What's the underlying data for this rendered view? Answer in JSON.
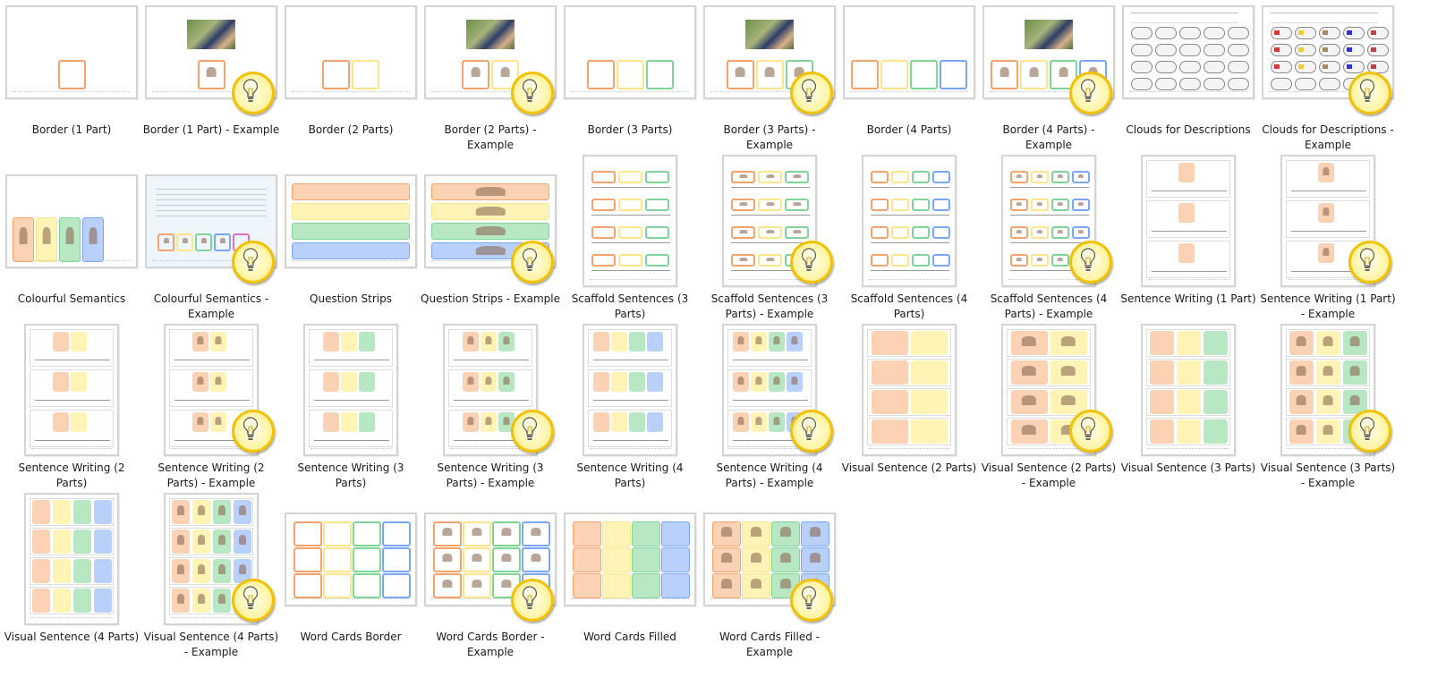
{
  "colors": {
    "orange": {
      "border": "#f5a36b",
      "fill": "#fbd2b4"
    },
    "yellow": {
      "border": "#fde58a",
      "fill": "#fff4b5"
    },
    "green": {
      "border": "#7fd49a",
      "fill": "#b8e8c3"
    },
    "blue": {
      "border": "#7aa7f5",
      "fill": "#b9d0fb"
    },
    "bulb_ring": "#f2c200"
  },
  "items": [
    {
      "label": "Border (1 Part)",
      "kind": "border",
      "parts": 1,
      "example": false
    },
    {
      "label": "Border (1 Part) - Example",
      "kind": "border",
      "parts": 1,
      "example": true
    },
    {
      "label": "Border (2 Parts)",
      "kind": "border",
      "parts": 2,
      "example": false
    },
    {
      "label": "Border (2 Parts) - Example",
      "kind": "border",
      "parts": 2,
      "example": true
    },
    {
      "label": "Border (3 Parts)",
      "kind": "border",
      "parts": 3,
      "example": false
    },
    {
      "label": "Border (3 Parts) - Example",
      "kind": "border",
      "parts": 3,
      "example": true
    },
    {
      "label": "Border (4 Parts)",
      "kind": "border",
      "parts": 4,
      "example": false
    },
    {
      "label": "Border (4 Parts) - Example",
      "kind": "border",
      "parts": 4,
      "example": true
    },
    {
      "label": "Clouds for Descriptions",
      "kind": "clouds",
      "parts": 0,
      "example": false
    },
    {
      "label": "Clouds for Descriptions - Example",
      "kind": "clouds",
      "parts": 0,
      "example": true
    },
    {
      "label": "Colourful Semantics",
      "kind": "colourful",
      "parts": 4,
      "example": false
    },
    {
      "label": "Colourful Semantics - Example",
      "kind": "colourful",
      "parts": 4,
      "example": true
    },
    {
      "label": "Question Strips",
      "kind": "strips",
      "parts": 4,
      "example": false
    },
    {
      "label": "Question Strips - Example",
      "kind": "strips",
      "parts": 4,
      "example": true
    },
    {
      "label": "Scaffold Sentences (3 Parts)",
      "kind": "scaffold",
      "parts": 3,
      "example": false
    },
    {
      "label": "Scaffold Sentences (3 Parts) - Example",
      "kind": "scaffold",
      "parts": 3,
      "example": true
    },
    {
      "label": "Scaffold Sentences (4 Parts)",
      "kind": "scaffold",
      "parts": 4,
      "example": false
    },
    {
      "label": "Scaffold Sentences (4 Parts) - Example",
      "kind": "scaffold",
      "parts": 4,
      "example": true
    },
    {
      "label": "Sentence Writing (1 Part)",
      "kind": "writing",
      "parts": 1,
      "example": false
    },
    {
      "label": "Sentence Writing (1 Part) - Example",
      "kind": "writing",
      "parts": 1,
      "example": true
    },
    {
      "label": "Sentence Writing (2 Parts)",
      "kind": "writing",
      "parts": 2,
      "example": false
    },
    {
      "label": "Sentence Writing (2 Parts) - Example",
      "kind": "writing",
      "parts": 2,
      "example": true
    },
    {
      "label": "Sentence Writing (3 Parts)",
      "kind": "writing",
      "parts": 3,
      "example": false
    },
    {
      "label": "Sentence Writing (3 Parts) - Example",
      "kind": "writing",
      "parts": 3,
      "example": true
    },
    {
      "label": "Sentence Writing (4 Parts)",
      "kind": "writing",
      "parts": 4,
      "example": false
    },
    {
      "label": "Sentence Writing (4 Parts) - Example",
      "kind": "writing",
      "parts": 4,
      "example": true
    },
    {
      "label": "Visual Sentence (2 Parts)",
      "kind": "visual",
      "parts": 2,
      "example": false
    },
    {
      "label": "Visual Sentence (2 Parts) - Example",
      "kind": "visual",
      "parts": 2,
      "example": true
    },
    {
      "label": "Visual Sentence (3 Parts)",
      "kind": "visual",
      "parts": 3,
      "example": false
    },
    {
      "label": "Visual Sentence (3 Parts) - Example",
      "kind": "visual",
      "parts": 3,
      "example": true
    },
    {
      "label": "Visual Sentence (4 Parts)",
      "kind": "visual",
      "parts": 4,
      "example": false
    },
    {
      "label": "Visual Sentence (4 Parts) - Example",
      "kind": "visual",
      "parts": 4,
      "example": true
    },
    {
      "label": "Word Cards Border",
      "kind": "cards-border",
      "parts": 4,
      "example": false
    },
    {
      "label": "Word Cards Border - Example",
      "kind": "cards-border",
      "parts": 4,
      "example": true
    },
    {
      "label": "Word Cards Filled",
      "kind": "cards-filled",
      "parts": 4,
      "example": false
    },
    {
      "label": "Word Cards Filled - Example",
      "kind": "cards-filled",
      "parts": 4,
      "example": true
    }
  ]
}
